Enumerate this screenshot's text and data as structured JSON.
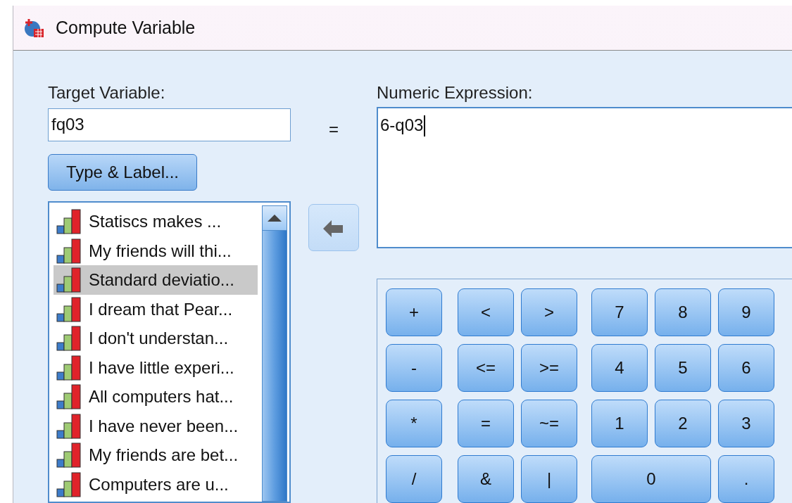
{
  "window": {
    "title": "Compute Variable"
  },
  "target_variable": {
    "label": "Target Variable:",
    "value": "fq03"
  },
  "equals_sign": "=",
  "type_label_button": "Type & Label...",
  "variables": [
    {
      "label": "Statiscs makes ...",
      "selected": false
    },
    {
      "label": "My friends will thi...",
      "selected": false
    },
    {
      "label": "Standard deviatio...",
      "selected": true
    },
    {
      "label": "I dream that Pear...",
      "selected": false
    },
    {
      "label": "I don't understan...",
      "selected": false
    },
    {
      "label": "I have little experi...",
      "selected": false
    },
    {
      "label": "All computers hat...",
      "selected": false
    },
    {
      "label": "I have never been...",
      "selected": false
    },
    {
      "label": "My friends are bet...",
      "selected": false
    },
    {
      "label": "Computers are u...",
      "selected": false
    }
  ],
  "numeric_expression": {
    "label": "Numeric Expression:",
    "value": "6-q03"
  },
  "keypad": [
    {
      "label": "+",
      "wide": false
    },
    {
      "label": "<",
      "wide": false
    },
    {
      "label": ">",
      "wide": false
    },
    {
      "label": "7",
      "wide": false
    },
    {
      "label": "8",
      "wide": false
    },
    {
      "label": "9",
      "wide": false
    },
    {
      "label": "-",
      "wide": false
    },
    {
      "label": "<=",
      "wide": false
    },
    {
      "label": ">=",
      "wide": false
    },
    {
      "label": "4",
      "wide": false
    },
    {
      "label": "5",
      "wide": false
    },
    {
      "label": "6",
      "wide": false
    },
    {
      "label": "*",
      "wide": false
    },
    {
      "label": "=",
      "wide": false
    },
    {
      "label": "~=",
      "wide": false
    },
    {
      "label": "1",
      "wide": false
    },
    {
      "label": "2",
      "wide": false
    },
    {
      "label": "3",
      "wide": false
    },
    {
      "label": "/",
      "wide": false
    },
    {
      "label": "&",
      "wide": false
    },
    {
      "label": "|",
      "wide": false
    },
    {
      "label": "0",
      "wide": true
    },
    {
      "label": ".",
      "wide": false
    }
  ]
}
